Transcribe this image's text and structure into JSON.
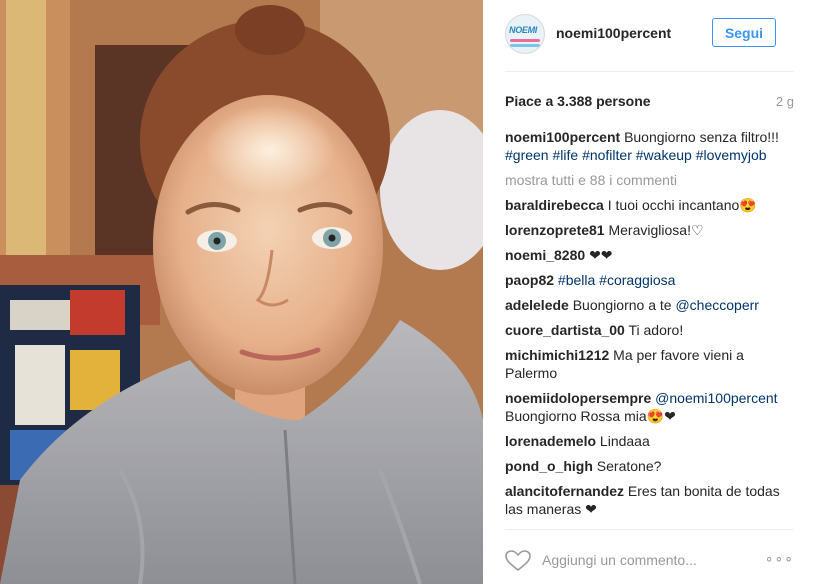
{
  "header": {
    "avatar_text": "NOEMI",
    "username": "noemi100percent",
    "follow_label": "Segui"
  },
  "stats": {
    "likes": "Piace a 3.388 persone",
    "time": "2 g"
  },
  "caption": {
    "user": "noemi100percent",
    "text": "Buongiorno senza filtro!!!",
    "tags": [
      "#green",
      "#life",
      "#nofilter",
      "#wakeup",
      "#lovemyjob"
    ]
  },
  "more_comments": "mostra tutti e 88 i commenti",
  "comments": [
    {
      "user": "baraldirebecca",
      "text": "I tuoi occhi incantano😍"
    },
    {
      "user": "lorenzoprete81",
      "text": "Meravigliosa!♡"
    },
    {
      "user": "noemi_8280",
      "text": "❤❤"
    },
    {
      "user": "paop82",
      "tags": [
        "#bella",
        "#coraggiosa"
      ]
    },
    {
      "user": "adelelede",
      "text": "Buongiorno a te",
      "mention": "@checcoperr"
    },
    {
      "user": "cuore_dartista_00",
      "text": "Ti adoro!"
    },
    {
      "user": "michimichi1212",
      "text": "Ma per favore vieni a Palermo"
    },
    {
      "user": "noemiidolopersempre",
      "mention": "@noemi100percent",
      "text": "Buongiorno Rossa mia😍❤"
    },
    {
      "user": "lorenademelo",
      "text": "Lindaaa"
    },
    {
      "user": "pond_o_high",
      "text": "Seratone?"
    },
    {
      "user": "alancitofernandez",
      "text": "Eres tan bonita de todas las maneras ❤"
    }
  ],
  "footer": {
    "add_comment_placeholder": "Aggiungi un commento...",
    "more_options": "∘∘∘"
  },
  "colors": {
    "accent": "#3897f0",
    "hashtag": "#003569",
    "muted": "#999999",
    "text": "#262626"
  },
  "icons": [
    "heart-icon",
    "more-options-icon"
  ]
}
